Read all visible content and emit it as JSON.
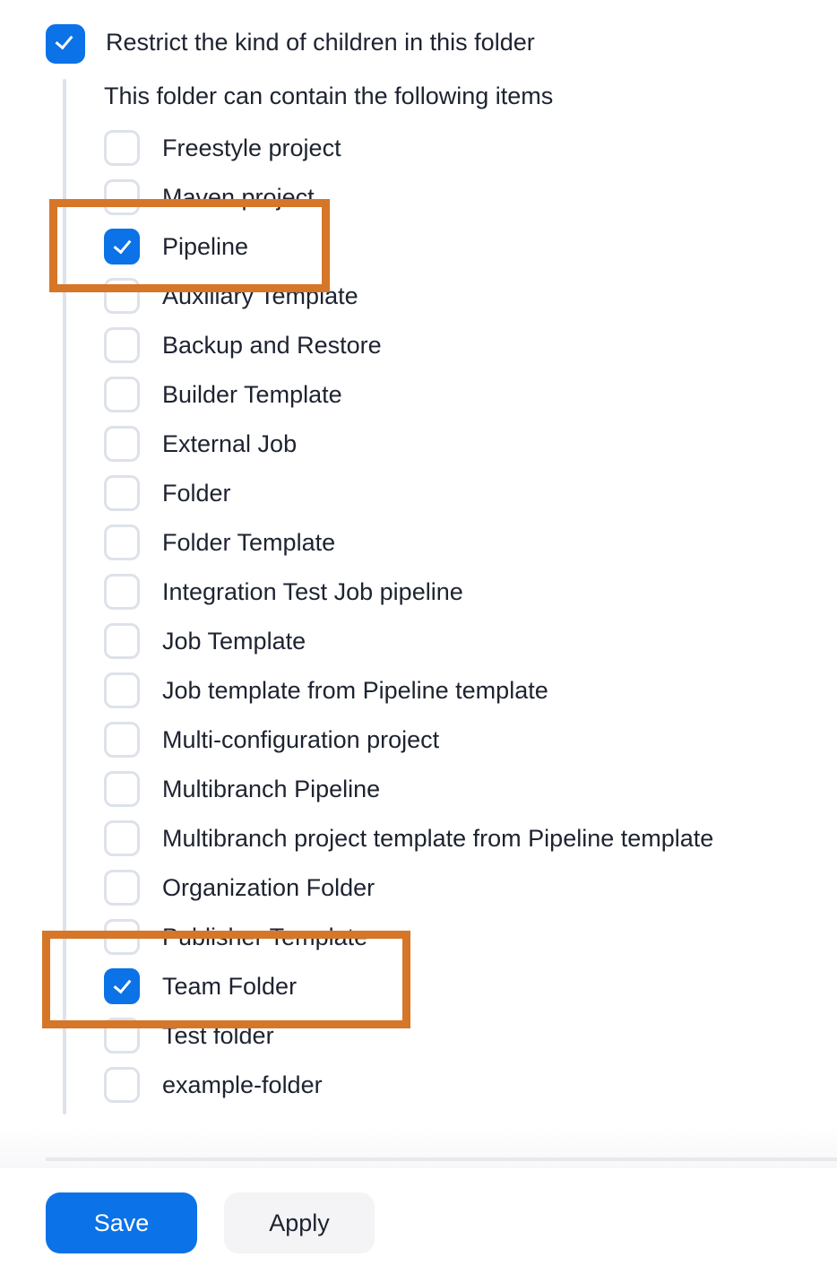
{
  "restrict": {
    "label": "Restrict the kind of children in this folder",
    "checked": true
  },
  "subheading": "This folder can contain the following items",
  "items": [
    {
      "label": "Freestyle project",
      "checked": false
    },
    {
      "label": "Maven project",
      "checked": false
    },
    {
      "label": "Pipeline",
      "checked": true,
      "highlighted": true
    },
    {
      "label": "Auxiliary Template",
      "checked": false
    },
    {
      "label": "Backup and Restore",
      "checked": false
    },
    {
      "label": "Builder Template",
      "checked": false
    },
    {
      "label": "External Job",
      "checked": false
    },
    {
      "label": "Folder",
      "checked": false
    },
    {
      "label": "Folder Template",
      "checked": false
    },
    {
      "label": "Integration Test Job pipeline",
      "checked": false
    },
    {
      "label": "Job Template",
      "checked": false
    },
    {
      "label": "Job template from Pipeline template",
      "checked": false
    },
    {
      "label": "Multi-configuration project",
      "checked": false
    },
    {
      "label": "Multibranch Pipeline",
      "checked": false
    },
    {
      "label": "Multibranch project template from Pipeline template",
      "checked": false
    },
    {
      "label": "Organization Folder",
      "checked": false
    },
    {
      "label": "Publisher Template",
      "checked": false
    },
    {
      "label": "Team Folder",
      "checked": true,
      "highlighted": true
    },
    {
      "label": "Test folder",
      "checked": false
    },
    {
      "label": "example-folder",
      "checked": false
    }
  ],
  "buttons": {
    "save": "Save",
    "apply": "Apply"
  },
  "colors": {
    "accent": "#0b72e7",
    "highlight": "#d67628"
  }
}
